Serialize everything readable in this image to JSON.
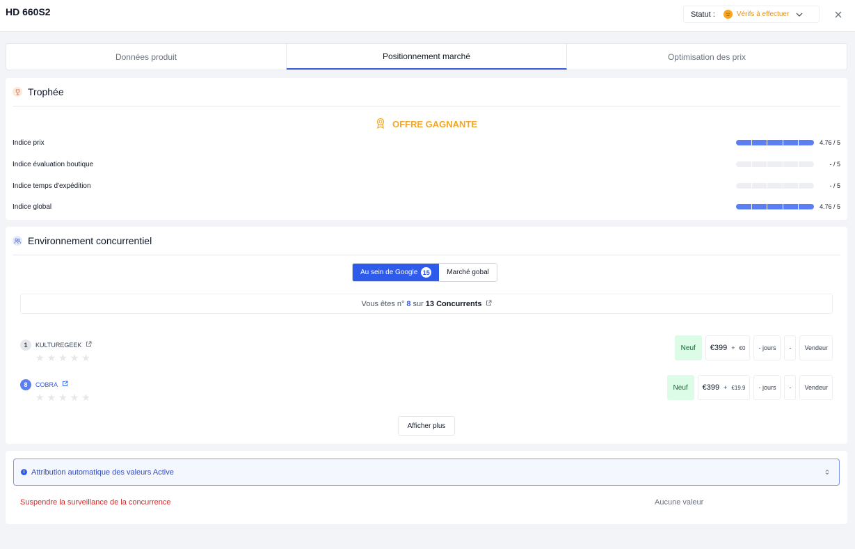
{
  "header": {
    "title": "HD 660S2",
    "status_label": "Statut :",
    "status_value": "Vérifs à effectuer"
  },
  "tabs": [
    {
      "label": "Données produit",
      "active": false
    },
    {
      "label": "Positionnement marché",
      "active": true
    },
    {
      "label": "Optimisation des prix",
      "active": false
    }
  ],
  "trophy": {
    "title": "Trophée",
    "winner_label": "OFFRE GAGNANTE",
    "indices": [
      {
        "label": "Indice prix",
        "score": "4.76 / 5",
        "filled": 5
      },
      {
        "label": "Indice évaluation boutique",
        "score": "- / 5",
        "filled": 0
      },
      {
        "label": "Indice temps d'expédition",
        "score": "- / 5",
        "filled": 0
      },
      {
        "label": "Indice global",
        "score": "4.76 / 5",
        "filled": 5
      }
    ]
  },
  "environment": {
    "title": "Environnement concurrentiel",
    "switch_google": "Au sein de Google",
    "switch_google_count": "15",
    "switch_global": "Marché gobal",
    "rank_prefix": "Vous êtes n°",
    "rank_value": "8",
    "rank_mid": "sur",
    "rank_total": "13 Concurrents",
    "competitors": [
      {
        "rank": "1",
        "name": "KULTUREGEEK",
        "condition": "Neuf",
        "price": "€399",
        "plus": "+",
        "shipping": "€0",
        "delay": "- jours",
        "dash": "-",
        "seller": "Vendeur"
      },
      {
        "rank": "8",
        "name": "COBRA",
        "condition": "Neuf",
        "price": "€399",
        "plus": "+",
        "shipping": "€19.9",
        "delay": "- jours",
        "dash": "-",
        "seller": "Vendeur"
      }
    ],
    "more_label": "Afficher plus"
  },
  "auto": {
    "info_text": "Attribution automatique des valeurs Active",
    "suspend_label": "Suspendre la surveillance de la concurrence",
    "no_value": "Aucune valeur"
  },
  "colors": {
    "accent": "#2f5bea",
    "bar_fill": "#5b7ff0",
    "gold": "#f5a623",
    "danger": "#dc2626",
    "new_bg": "#dcfce7"
  },
  "icons": {
    "status": "emoji-neutral-icon",
    "close": "close-icon",
    "trophy": "trophy-icon",
    "winner": "award-ribbon-icon",
    "competition": "users-icon",
    "external": "external-link-icon",
    "star": "star-icon",
    "info": "info-icon",
    "caret": "updown-caret-icon"
  }
}
